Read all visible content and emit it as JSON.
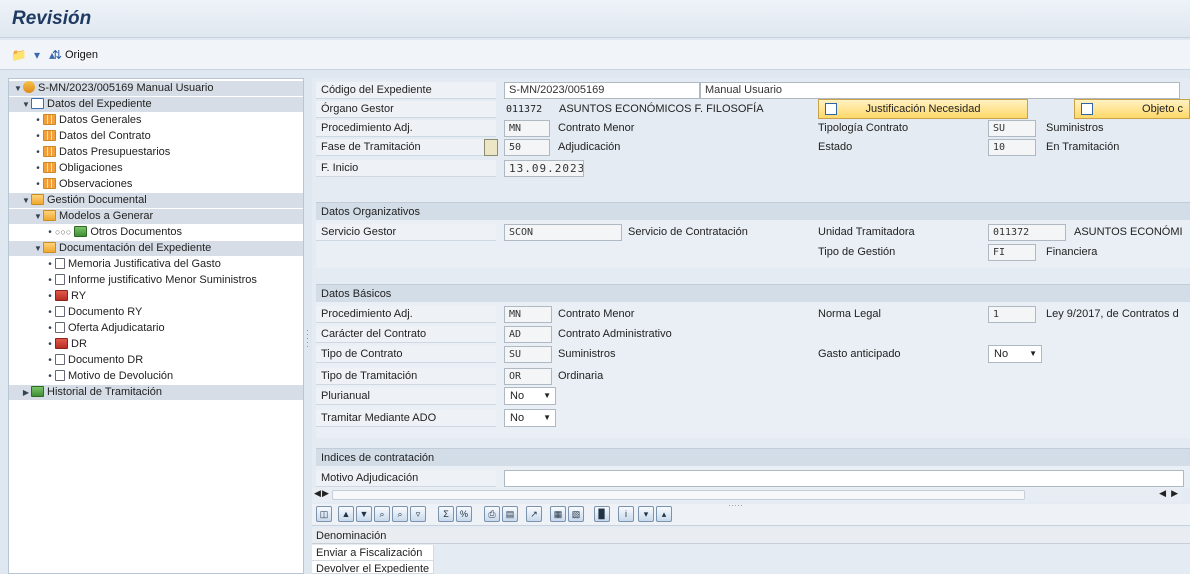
{
  "window": {
    "title": "Revisión"
  },
  "toolbar": {
    "origin_label": "Origen"
  },
  "tree": [
    {
      "label": "S-MN/2023/005169 Manual Usuario",
      "icon": "organization-icon",
      "expanded": true
    },
    {
      "label": "Datos del Expediente",
      "icon": "stack-icon",
      "expanded": true
    },
    {
      "label": "Datos Generales",
      "icon": "grid-icon"
    },
    {
      "label": "Datos del Contrato",
      "icon": "grid-icon"
    },
    {
      "label": "Datos Presupuestarios",
      "icon": "grid-icon"
    },
    {
      "label": "Obligaciones",
      "icon": "grid-icon"
    },
    {
      "label": "Observaciones",
      "icon": "grid-icon"
    },
    {
      "label": "Gestión Documental",
      "icon": "folder-icon",
      "expanded": true
    },
    {
      "label": "Modelos a Generar",
      "icon": "folder-icon",
      "expanded": true
    },
    {
      "label": "Otros Documentos",
      "icon": "document-icon"
    },
    {
      "label": "Documentación del Expediente",
      "icon": "folder-icon",
      "expanded": true
    },
    {
      "label": "Memoria Justificativa del Gasto",
      "icon": "document-icon"
    },
    {
      "label": "Informe justificativo Menor Suministros",
      "icon": "document-icon"
    },
    {
      "label": "RY",
      "icon": "red-doc-icon"
    },
    {
      "label": "Documento RY",
      "icon": "document-icon"
    },
    {
      "label": "Oferta Adjudicatario",
      "icon": "document-icon"
    },
    {
      "label": "DR",
      "icon": "red-doc-icon"
    },
    {
      "label": "Documento DR",
      "icon": "document-icon"
    },
    {
      "label": "Motivo de Devolución",
      "icon": "document-icon"
    },
    {
      "label": "Historial de Tramitación",
      "icon": "hierarchy-icon"
    }
  ],
  "header": {
    "codigo_label": "Código del Expediente",
    "codigo_value": "S-MN/2023/005169",
    "descripcion_value": "Manual Usuario",
    "organo_label": "Órgano Gestor",
    "organo_code": "011372",
    "organo_text": "ASUNTOS ECONÓMICOS F. FILOSOFÍA",
    "just_button": "Justificación Necesidad",
    "objeto_button": "Objeto c",
    "proc_label": "Procedimiento Adj.",
    "proc_code": "MN",
    "proc_text": "Contrato Menor",
    "tipologia_label": "Tipología Contrato",
    "tipologia_code": "SU",
    "tipologia_text": "Suministros",
    "fase_label": "Fase de Tramitación",
    "fase_code": "50",
    "fase_text": "Adjudicación",
    "estado_label": "Estado",
    "estado_code": "10",
    "estado_text": "En Tramitación",
    "inicio_label": "F. Inicio",
    "inicio_value": "13.09.2023"
  },
  "org": {
    "title": "Datos Organizativos",
    "servicio_label": "Servicio Gestor",
    "servicio_code": "SCON",
    "servicio_text": "Servicio de Contratación",
    "unidad_label": "Unidad Tramitadora",
    "unidad_code": "011372",
    "unidad_text": "ASUNTOS ECONÓMI",
    "tipo_gestion_label": "Tipo de Gestión",
    "tipo_gestion_code": "FI",
    "tipo_gestion_text": "Financiera"
  },
  "basic": {
    "title": "Datos Básicos",
    "proc_label": "Procedimiento Adj.",
    "proc_code": "MN",
    "proc_text": "Contrato Menor",
    "norma_label": "Norma Legal",
    "norma_code": "1",
    "norma_text": "Ley 9/2017, de Contratos d",
    "caracter_label": "Carácter del Contrato",
    "caracter_code": "AD",
    "caracter_text": "Contrato Administrativo",
    "tipo_label": "Tipo de Contrato",
    "tipo_code": "SU",
    "tipo_text": "Suministros",
    "gasto_label": "Gasto anticipado",
    "gasto_value": "No",
    "tramitacion_label": "Tipo de Tramitación",
    "tramitacion_code": "OR",
    "tramitacion_text": "Ordinaria",
    "plurianual_label": "Plurianual",
    "plurianual_value": "No",
    "ado_label": "Tramitar Mediante ADO",
    "ado_value": "No"
  },
  "indices": {
    "title": "Indices de contratación",
    "motivo_label": "Motivo Adjudicación",
    "motivo_value": ""
  },
  "grid": {
    "header": "Denominación",
    "rows": [
      "Enviar a Fiscalización",
      "Devolver el Expediente"
    ]
  },
  "colors": {
    "selected_row": "#d6dde6",
    "button_yellow": "#ffd86a",
    "title": "#1f3a63"
  }
}
